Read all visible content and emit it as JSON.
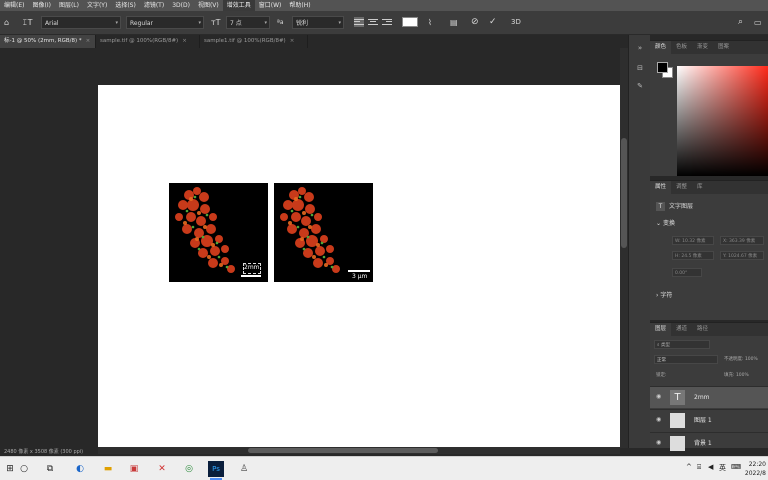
{
  "menu": [
    "编辑(E)",
    "图像(I)",
    "图层(L)",
    "文字(Y)",
    "选择(S)",
    "滤镜(T)",
    "3D(D)",
    "视图(V)",
    "增效工具",
    "窗口(W)",
    "帮助(H)"
  ],
  "options": {
    "font_family": "Arial",
    "font_style": "Regular",
    "font_size": "7 点",
    "antialias": "锐利",
    "commit_label": "3D"
  },
  "tabs": [
    {
      "label": "标-1 @ 50% (2mm, RGB/8) *"
    },
    {
      "label": "sample.tif @ 100%(RGB/8#)"
    },
    {
      "label": "sample1.tif @ 100%(RGB/8#)"
    }
  ],
  "canvas": {
    "images": [
      {
        "scale_label": "2mm"
      },
      {
        "scale_label": "3 μm"
      }
    ]
  },
  "status": "2480 像素 x 3508 像素 (300 ppi)",
  "color_panel": {
    "tabs": [
      "颜色",
      "色板",
      "渐变",
      "图案"
    ],
    "fg": "#000000",
    "bg": "#ffffff"
  },
  "properties": {
    "tabs": [
      "属性",
      "调整",
      "库"
    ],
    "layer_type": "文字图层",
    "transform": "变换",
    "w": "W: 10.32 像素",
    "h": "H: 24.5 像素",
    "x": "X: 363.39 像素",
    "y": "Y: 1024.67 像素",
    "angle": "0.00°",
    "char": "字符"
  },
  "layers": {
    "tabs": [
      "图层",
      "通道",
      "路径"
    ],
    "search": "类型",
    "blend": "正常",
    "opacity": "不透明度: 100%",
    "lock_label": "锁定:",
    "fill": "填充: 100%",
    "items": [
      {
        "name": "2mm",
        "thumb": "T"
      },
      {
        "name": "图层 1",
        "thumb": ""
      },
      {
        "name": "背景 1",
        "thumb": ""
      }
    ]
  },
  "taskbar": {
    "tray_lang": "英",
    "time": "22:20",
    "date": "2022/8"
  }
}
